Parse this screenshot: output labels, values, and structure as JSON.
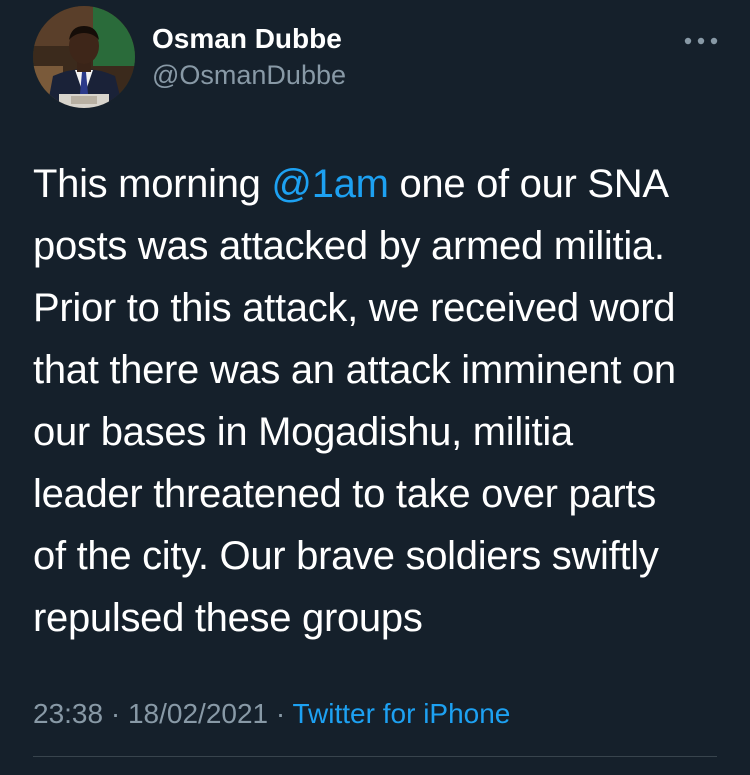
{
  "colors": {
    "background": "#15202b",
    "text": "#ffffff",
    "secondary_text": "#8899a6",
    "link": "#1da1f2",
    "divider": "#38444d"
  },
  "author": {
    "display_name": "Osman Dubbe",
    "handle": "@OsmanDubbe",
    "avatar_icon": "profile-photo"
  },
  "more_icon": "more-options-icon",
  "tweet": {
    "lines": [
      {
        "before": "This morning ",
        "mention": "@1am",
        "after": " one of our SNA"
      },
      {
        "text": "posts was attacked by armed militia."
      },
      {
        "text": "Prior to this attack, we received word"
      },
      {
        "text": "that there was an attack imminent on"
      },
      {
        "text": "our bases in Mogadishu, militia"
      },
      {
        "text": "leader threatened to take over parts"
      },
      {
        "text": "of the city. Our brave soldiers swiftly"
      },
      {
        "text": "repulsed these groups"
      }
    ]
  },
  "meta": {
    "time": "23:38",
    "separator": "·",
    "date": "18/02/2021",
    "source": "Twitter for iPhone"
  }
}
